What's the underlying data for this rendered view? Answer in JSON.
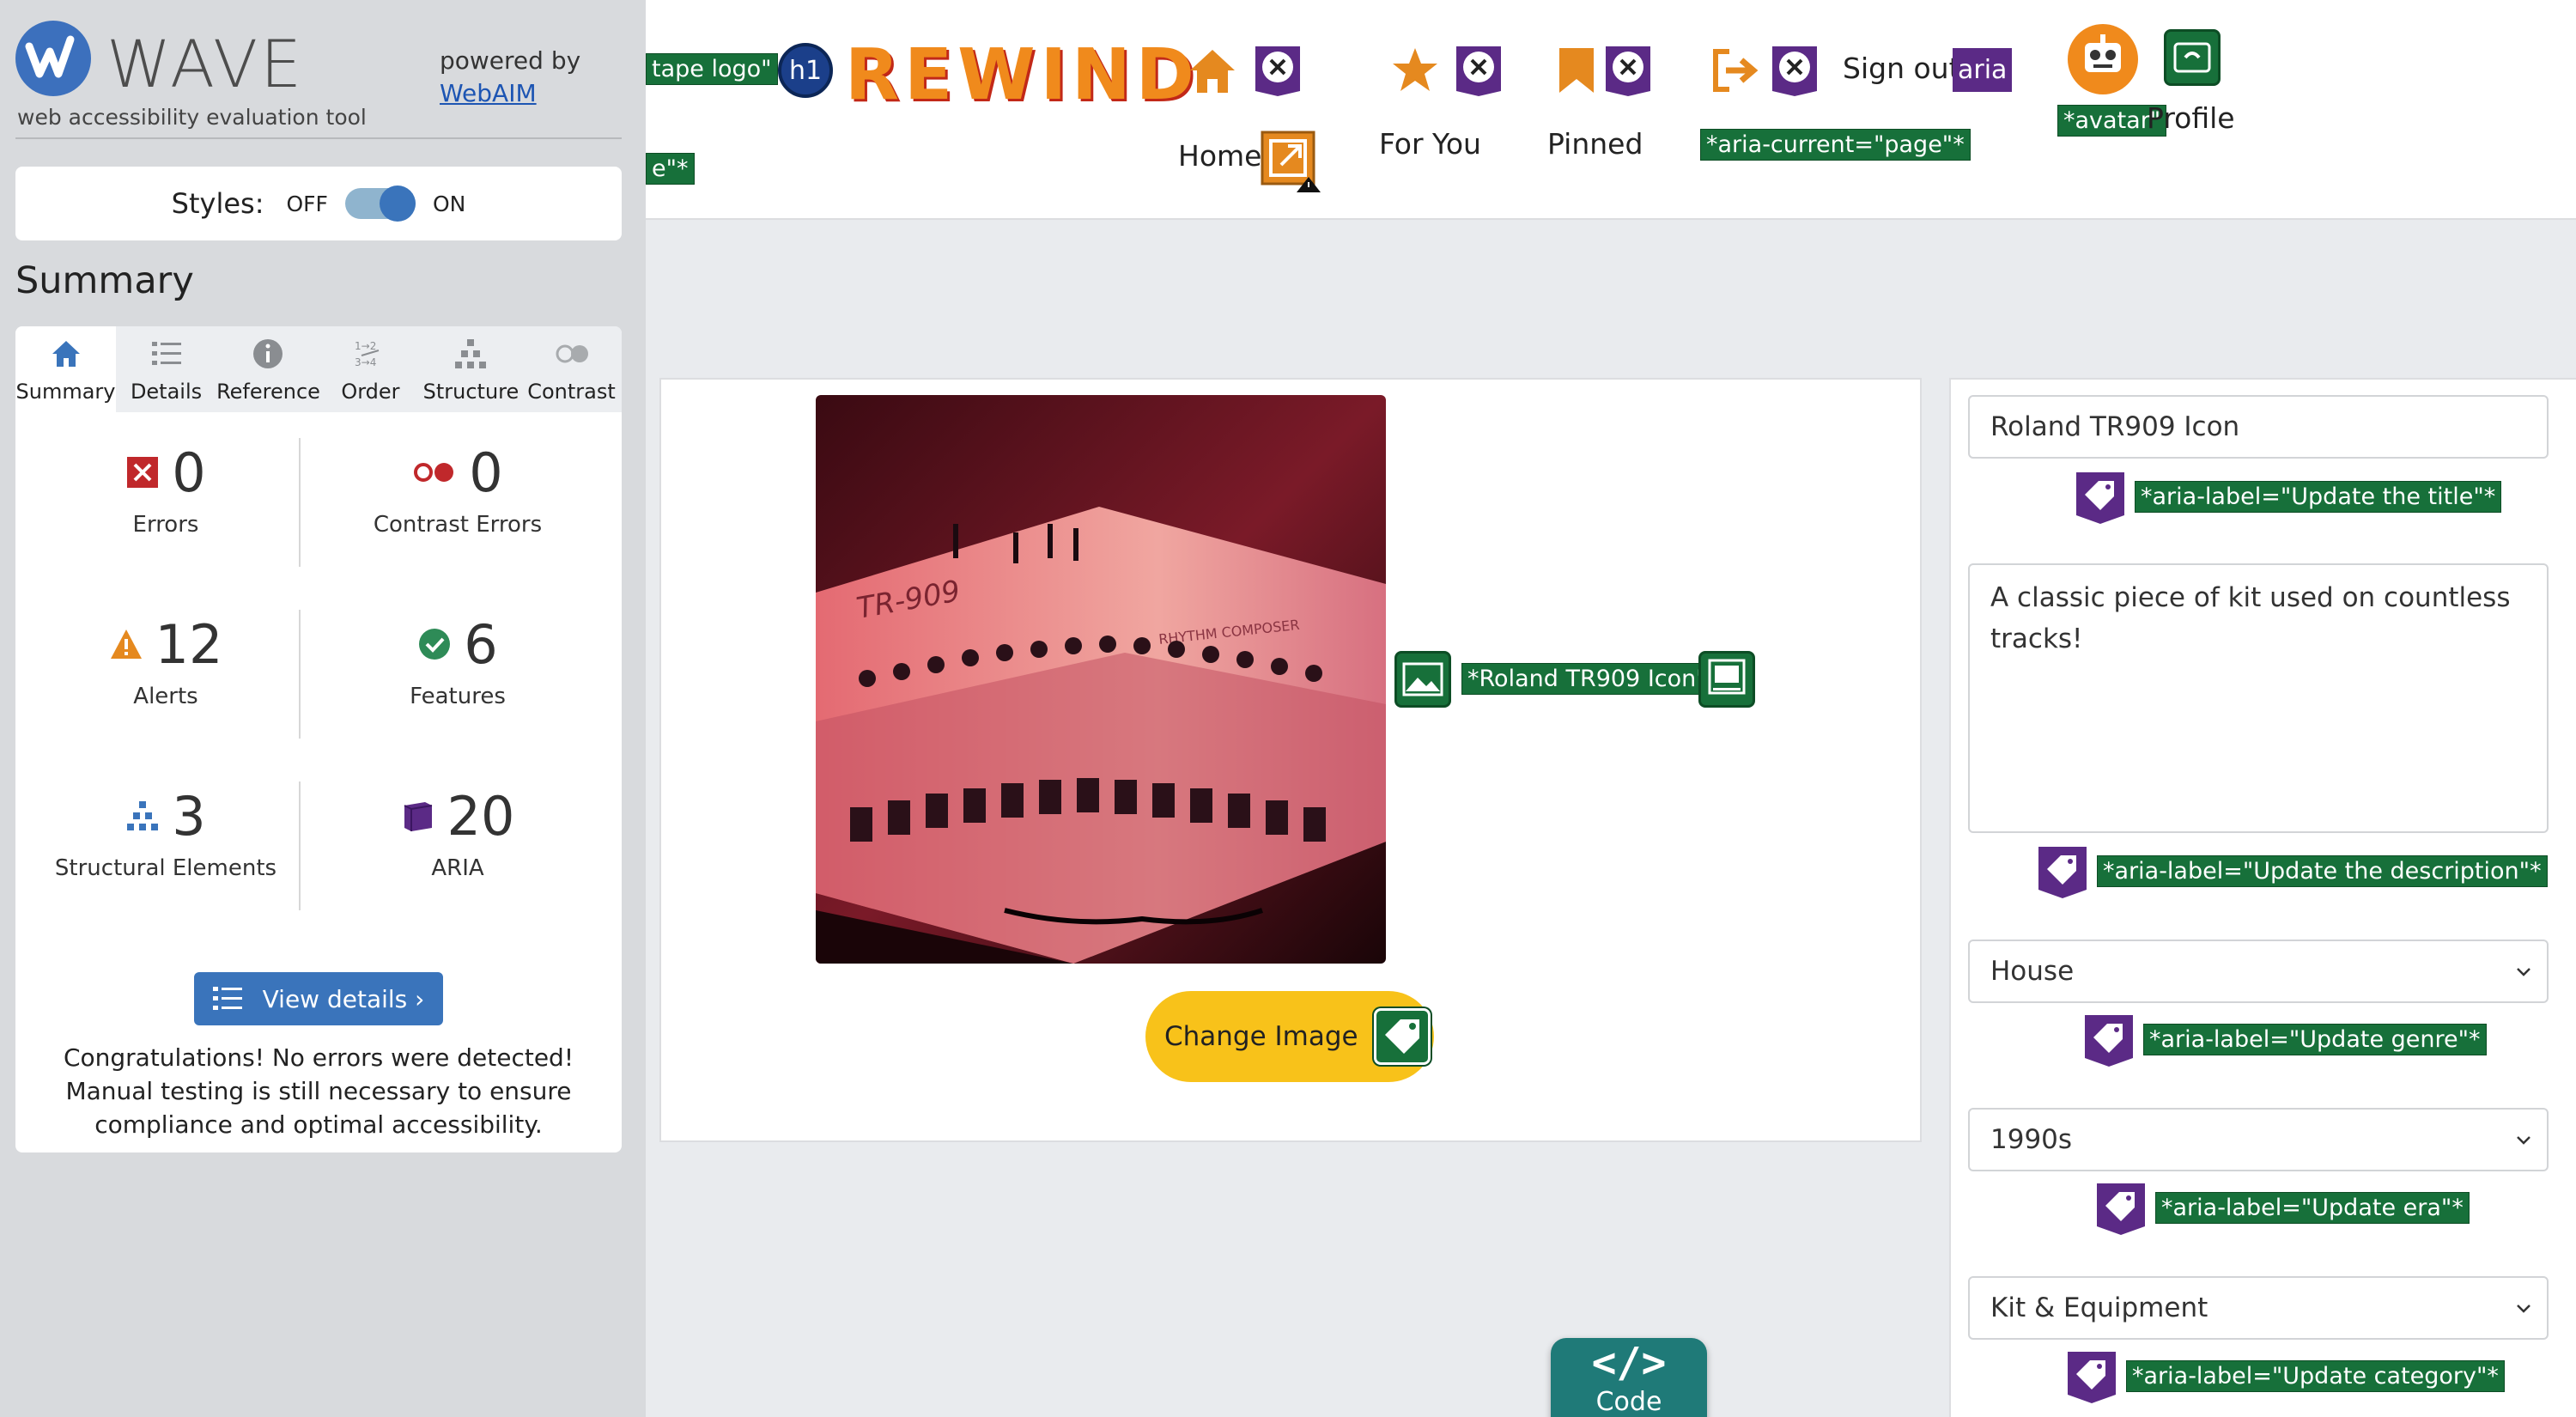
{
  "wave": {
    "title": "WAVE",
    "tagline": "web accessibility evaluation tool",
    "powered_by": "powered by",
    "webaim": "WebAIM",
    "styles_label": "Styles:",
    "styles_off": "OFF",
    "styles_on": "ON",
    "summary_heading": "Summary",
    "tabs": [
      {
        "label": "Summary",
        "icon": "home-icon",
        "active": true
      },
      {
        "label": "Details",
        "icon": "list-icon"
      },
      {
        "label": "Reference",
        "icon": "info-icon"
      },
      {
        "label": "Order",
        "icon": "order-icon"
      },
      {
        "label": "Structure",
        "icon": "structure-icon"
      },
      {
        "label": "Contrast",
        "icon": "contrast-icon"
      }
    ],
    "stats": {
      "errors": {
        "value": "0",
        "label": "Errors"
      },
      "contrast_errors": {
        "value": "0",
        "label": "Contrast Errors"
      },
      "alerts": {
        "value": "12",
        "label": "Alerts"
      },
      "features": {
        "value": "6",
        "label": "Features"
      },
      "structural": {
        "value": "3",
        "label": "Structural Elements"
      },
      "aria": {
        "value": "20",
        "label": "ARIA"
      }
    },
    "view_details": "View details ›",
    "congrats": "Congratulations! No errors were detected! Manual testing is still necessary to ensure compliance and optimal accessibility."
  },
  "header": {
    "logo_alt_tag": "tape logo\"",
    "partial_tag": "e\"*",
    "h1_badge": "h1",
    "brand": "REWIND",
    "nav": {
      "home": "Home",
      "for_you": "For You",
      "pinned": "Pinned",
      "sign_out": "Sign out",
      "aria_badge": "aria",
      "aria_current": "*aria-current=\"page\"*",
      "avatar_tag": "*avatar\"",
      "profile": "Profile"
    }
  },
  "content": {
    "image_alt": "*Roland TR909 Icon\"",
    "photo_text_model": "TR-909",
    "photo_text_sub": "RHYTHM COMPOSER",
    "change_image": "Change Image",
    "code_label": "Code",
    "code_glyph": "</>"
  },
  "form": {
    "title_value": "Roland TR909 Icon",
    "title_aria": "*aria-label=\"Update the title\"*",
    "description_value": "A classic piece of kit used on countless tracks!",
    "description_aria": "*aria-label=\"Update the description\"*",
    "genre_value": "House",
    "genre_aria": "*aria-label=\"Update genre\"*",
    "era_value": "1990s",
    "era_aria": "*aria-label=\"Update era\"*",
    "category_value": "Kit & Equipment",
    "category_aria": "*aria-label=\"Update category\"*"
  },
  "colors": {
    "wave_blue": "#3a74bb",
    "wave_green": "#17703a",
    "aria_purple": "#5b2a86",
    "brand_orange": "#f08a1c",
    "button_yellow": "#f8c21a"
  }
}
